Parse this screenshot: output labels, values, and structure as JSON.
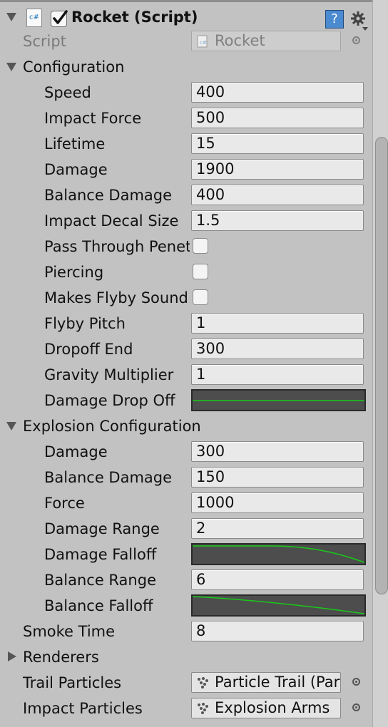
{
  "component": {
    "title": "Rocket (Script)",
    "script_label": "Script",
    "script_value": "Rocket",
    "script_icon_text": "c#"
  },
  "configuration": {
    "label": "Configuration",
    "fields": [
      {
        "label": "Speed",
        "value": "400"
      },
      {
        "label": "Impact Force",
        "value": "500"
      },
      {
        "label": "Lifetime",
        "value": "15"
      },
      {
        "label": "Damage",
        "value": "1900"
      },
      {
        "label": "Balance Damage",
        "value": "400"
      },
      {
        "label": "Impact Decal Size",
        "value": "1.5"
      }
    ],
    "toggles": [
      {
        "label": "Pass Through Penetrable",
        "checked": false
      },
      {
        "label": "Piercing",
        "checked": false
      },
      {
        "label": "Makes Flyby Sound",
        "checked": false
      }
    ],
    "fields2": [
      {
        "label": "Flyby Pitch",
        "value": "1"
      },
      {
        "label": "Dropoff End",
        "value": "300"
      },
      {
        "label": "Gravity Multiplier",
        "value": "1"
      }
    ],
    "curve_label": "Damage Drop Off"
  },
  "explosion": {
    "label": "Explosion Configuration",
    "damage": {
      "label": "Damage",
      "value": "300"
    },
    "balance_damage": {
      "label": "Balance Damage",
      "value": "150"
    },
    "force": {
      "label": "Force",
      "value": "1000"
    },
    "damage_range": {
      "label": "Damage Range",
      "value": "2"
    },
    "damage_falloff_label": "Damage Falloff",
    "balance_range": {
      "label": "Balance Range",
      "value": "6"
    },
    "balance_falloff_label": "Balance Falloff"
  },
  "smoke_time": {
    "label": "Smoke Time",
    "value": "8"
  },
  "renderers": {
    "label": "Renderers"
  },
  "trail_particles": {
    "label": "Trail Particles",
    "value": "Particle Trail (Particle System)"
  },
  "impact_particles": {
    "label": "Impact Particles",
    "value": "Explosion Arms"
  },
  "icons": {
    "help": "?",
    "foldout_open": "triangle-down",
    "foldout_closed": "triangle-right",
    "settings": "gear"
  },
  "colors": {
    "curve_line": "#19c919",
    "accent_blue": "#1b75bc",
    "panel_bg": "#c2c2c2"
  }
}
